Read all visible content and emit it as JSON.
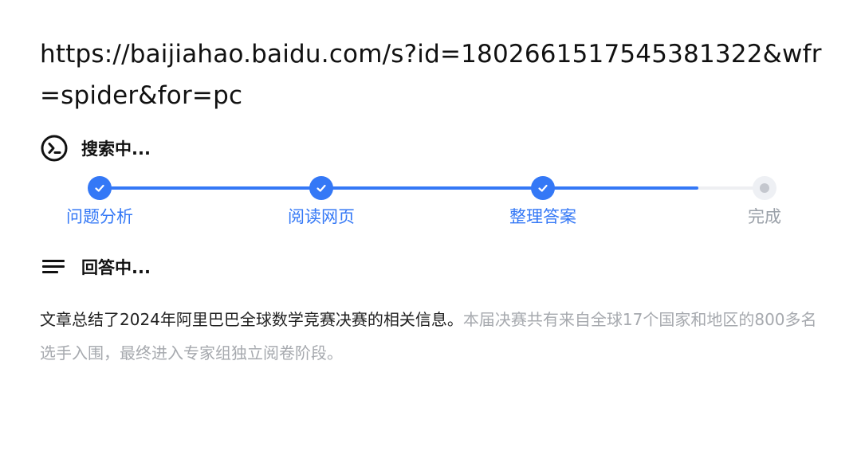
{
  "url_text": "https://baijiahao.baidu.com/s?id=1802661517545381322&wfr=spider&for=pc",
  "status_searching": {
    "icon": "terminal-icon",
    "label": "搜索中..."
  },
  "progress": {
    "accent_color": "#3478f6",
    "current_step_progress": 0.7,
    "steps": [
      {
        "label": "问题分析",
        "state": "done"
      },
      {
        "label": "阅读网页",
        "state": "done"
      },
      {
        "label": "整理答案",
        "state": "done"
      },
      {
        "label": "完成",
        "state": "pending"
      }
    ]
  },
  "status_answering": {
    "icon": "text-lines-icon",
    "label": "回答中..."
  },
  "answer": {
    "text_dark": "文章总结了2024年阿里巴巴全球数学竞赛决赛的相关信息。",
    "text_faded": "本届决赛共有来自全球17个国家和地区的800多名选手入围，最终进入专家组独立阅卷阶段。"
  }
}
